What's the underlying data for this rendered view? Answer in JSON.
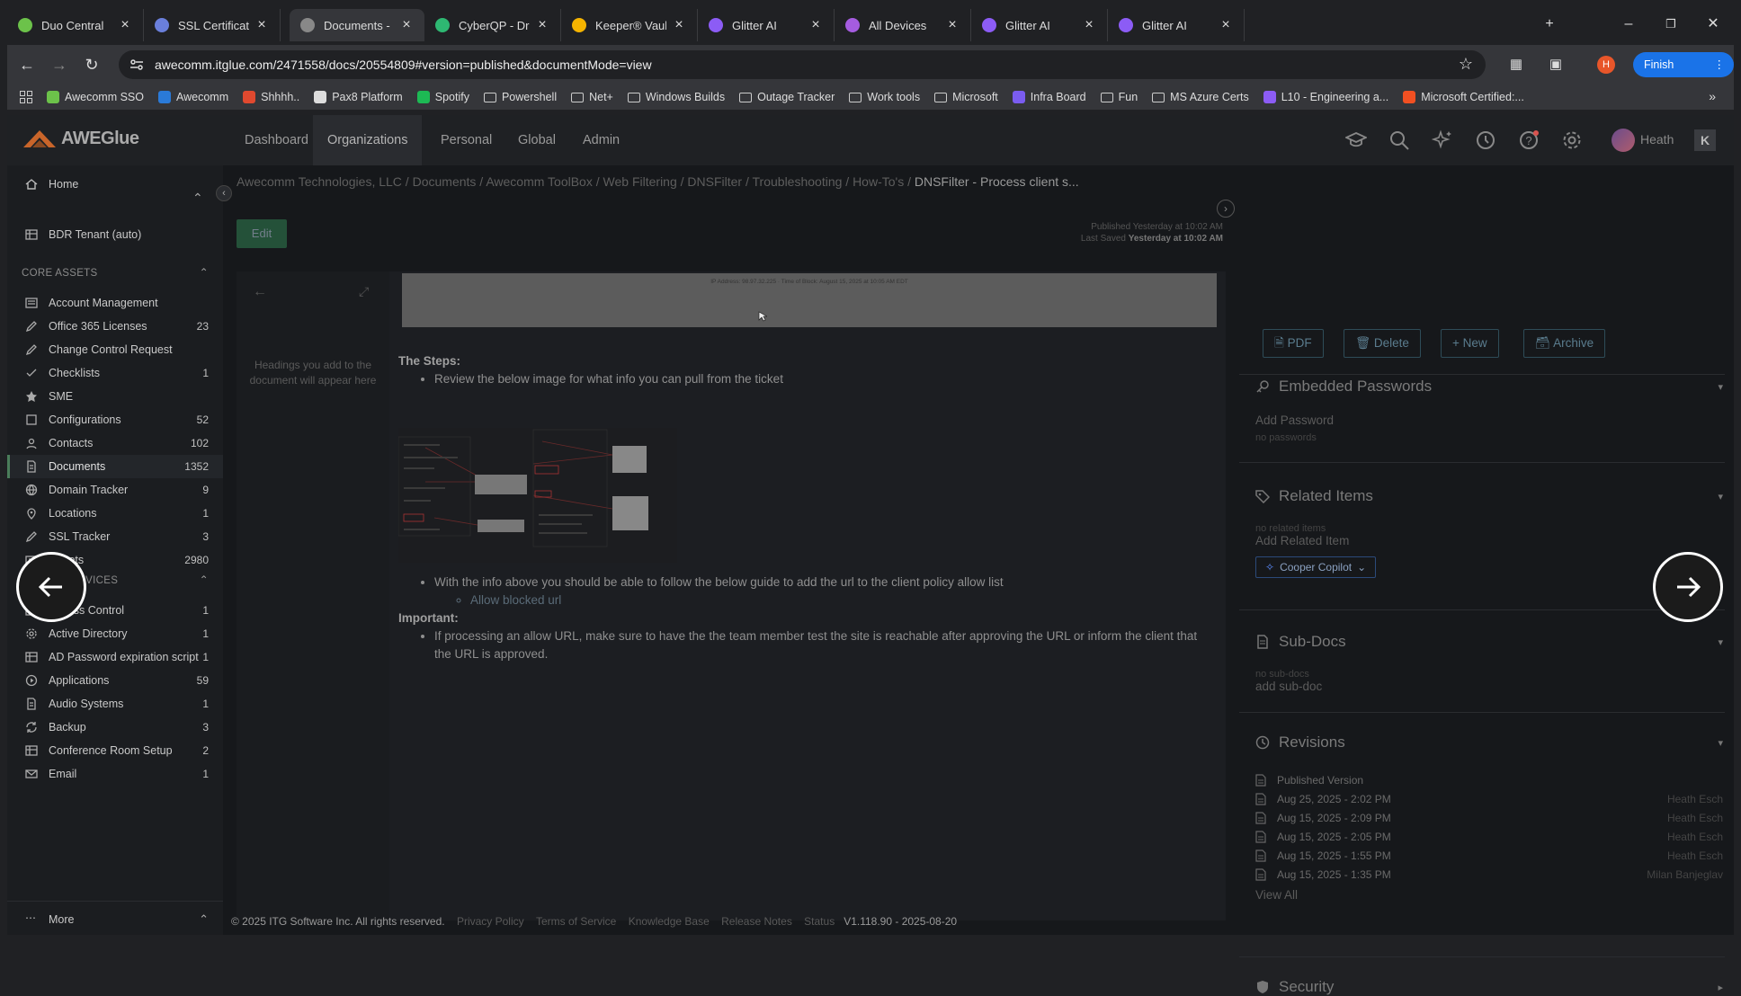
{
  "tabs": [
    {
      "title": "Duo Central",
      "icon": "duo-icon",
      "color": "#6cc24a"
    },
    {
      "title": "SSL Certificate | DNSF",
      "icon": "ssl-icon",
      "color": "#6a7fdb"
    },
    {
      "title": "Documents - DNSFilte",
      "icon": "itglue-icon",
      "color": "#888"
    },
    {
      "title": "CyberQP - Drake Ente",
      "icon": "cyberqp-icon",
      "color": "#2eb872"
    },
    {
      "title": "Keeper® Vault - hescl",
      "icon": "keeper-icon",
      "color": "#f5b400"
    },
    {
      "title": "Glitter AI",
      "icon": "glitter-icon",
      "color": "#8c5cf5"
    },
    {
      "title": "All Devices",
      "icon": "devices-icon",
      "color": "#a55ce0"
    },
    {
      "title": "Glitter AI",
      "icon": "glitter-icon",
      "color": "#8c5cf5"
    },
    {
      "title": "Glitter AI",
      "icon": "glitter-icon",
      "color": "#8c5cf5"
    }
  ],
  "address": "awecomm.itglue.com/2471558/docs/20554809#version=published&documentMode=view",
  "profile_initial": "H",
  "finish_update": "Finish update",
  "bookmarks": [
    {
      "label": "Awecomm SSO",
      "color": "#6cc24a"
    },
    {
      "label": "Awecomm",
      "color": "#2a7ad8"
    },
    {
      "label": "Shhhh..",
      "color": "#e0492f"
    },
    {
      "label": "Pax8 Platform",
      "color": "#ddd"
    },
    {
      "label": "Spotify",
      "color": "#1db954"
    },
    {
      "label": "Powershell",
      "color": "folder"
    },
    {
      "label": "Net+",
      "color": "folder"
    },
    {
      "label": "Windows Builds",
      "color": "folder"
    },
    {
      "label": "Outage Tracker",
      "color": "folder"
    },
    {
      "label": "Work tools",
      "color": "folder"
    },
    {
      "label": "Microsoft",
      "color": "folder"
    },
    {
      "label": "Infra Board",
      "color": "#7a5cf0"
    },
    {
      "label": "Fun",
      "color": "folder"
    },
    {
      "label": "MS Azure Certs",
      "color": "folder"
    },
    {
      "label": "L10 - Engineering a...",
      "color": "#8c5cf5"
    },
    {
      "label": "Microsoft Certified:...",
      "color": "#f25022"
    }
  ],
  "app": {
    "logo": "AWEGlue",
    "nav": [
      "Dashboard",
      "Organizations",
      "Personal",
      "Global",
      "Admin"
    ],
    "user": "Heath"
  },
  "sidebar": {
    "home": "Home",
    "pinned": [
      {
        "label": "BDR Tenant (auto)",
        "icon": "table-icon",
        "count": ""
      }
    ],
    "core_title": "CORE ASSETS",
    "core": [
      {
        "label": "Account Management",
        "count": "",
        "icon": "list-icon"
      },
      {
        "label": "Office 365 Licenses",
        "count": "23",
        "icon": "edit-icon"
      },
      {
        "label": "Change Control Request",
        "count": "",
        "icon": "edit-icon"
      },
      {
        "label": "Checklists",
        "count": "1",
        "icon": "check-icon"
      },
      {
        "label": "SME",
        "count": "",
        "icon": "star-icon"
      },
      {
        "label": "Configurations",
        "count": "52",
        "icon": "config-icon"
      },
      {
        "label": "Contacts",
        "count": "102",
        "icon": "contacts-icon"
      },
      {
        "label": "Documents",
        "count": "1352",
        "icon": "doc-icon"
      },
      {
        "label": "Domain Tracker",
        "count": "9",
        "icon": "globe-icon"
      },
      {
        "label": "Locations",
        "count": "1",
        "icon": "pin-icon"
      },
      {
        "label": "SSL Tracker",
        "count": "3",
        "icon": "edit-icon"
      },
      {
        "label": "Tickets",
        "count": "2980",
        "icon": "ticket-icon"
      }
    ],
    "apps_title": "APPS & SERVICES",
    "apps": [
      {
        "label": "Access Control",
        "count": "1",
        "icon": "table-icon"
      },
      {
        "label": "Active Directory",
        "count": "1",
        "icon": "gear-icon"
      },
      {
        "label": "AD Password expiration script",
        "count": "1",
        "icon": "table-icon"
      },
      {
        "label": "Applications",
        "count": "59",
        "icon": "play-icon"
      },
      {
        "label": "Audio Systems",
        "count": "1",
        "icon": "doc-icon"
      },
      {
        "label": "Backup",
        "count": "3",
        "icon": "sync-icon"
      },
      {
        "label": "Conference Room Setup",
        "count": "2",
        "icon": "table-icon"
      },
      {
        "label": "Email",
        "count": "1",
        "icon": "mail-icon"
      }
    ],
    "more": "More"
  },
  "breadcrumbs": [
    "Awecomm Technologies, LLC",
    "Documents",
    "Awecomm ToolBox",
    "Web Filtering",
    "DNSFilter",
    "Troubleshooting / How-To's",
    "DNSFilter - Process client s..."
  ],
  "edit_label": "Edit",
  "published": {
    "line1": "Published Yesterday at 10:02 AM",
    "line2_label": "Last Saved",
    "line2_value": "Yesterday at 10:02 AM"
  },
  "toc_msg": "Headings you add to the document will appear here",
  "image_caption": "IP Address: 98.97.32.225 · Time of Block: August 15, 2025 at 10:05 AM EDT",
  "steps": {
    "heading": "The Steps:",
    "item1": "Review the below image for what info you can pull from the ticket",
    "item2": "With the info above you should be able to follow the below guide to add the url to the client policy allow list",
    "sub1": "Allow blocked url",
    "important": "Important:",
    "item3": "If processing an allow URL, make sure to have the the team member test the site is reachable after approving the URL or inform the client that the URL is approved."
  },
  "actions": [
    "PDF",
    "Delete",
    "New",
    "Archive"
  ],
  "panel": {
    "passwords": {
      "title": "Embedded Passwords",
      "add": "Add Password",
      "empty": "no passwords"
    },
    "related": {
      "title": "Related Items",
      "empty": "no related items",
      "add": "Add Related Item",
      "copilot": "Cooper Copilot"
    },
    "subdocs": {
      "title": "Sub-Docs",
      "empty": "no sub-docs",
      "add": "add sub-doc"
    },
    "revisions": {
      "title": "Revisions",
      "items": [
        {
          "date": "Published Version",
          "by": ""
        },
        {
          "date": "Aug 25, 2025 - 2:02 PM",
          "by": "Heath Esch"
        },
        {
          "date": "Aug 15, 2025 - 2:09 PM",
          "by": "Heath Esch"
        },
        {
          "date": "Aug 15, 2025 - 2:05 PM",
          "by": "Heath Esch"
        },
        {
          "date": "Aug 15, 2025 - 1:55 PM",
          "by": "Heath Esch"
        },
        {
          "date": "Aug 15, 2025 - 1:35 PM",
          "by": "Milan Banjeglav"
        }
      ],
      "view_all": "View All"
    },
    "security": {
      "title": "Security"
    }
  },
  "footer": {
    "copyright": "© 2025 ITG Software Inc. All rights reserved.",
    "links": [
      "Privacy Policy",
      "Terms of Service",
      "Knowledge Base",
      "Release Notes",
      "Status"
    ],
    "version": "V1.118.90 - 2025-08-20"
  }
}
